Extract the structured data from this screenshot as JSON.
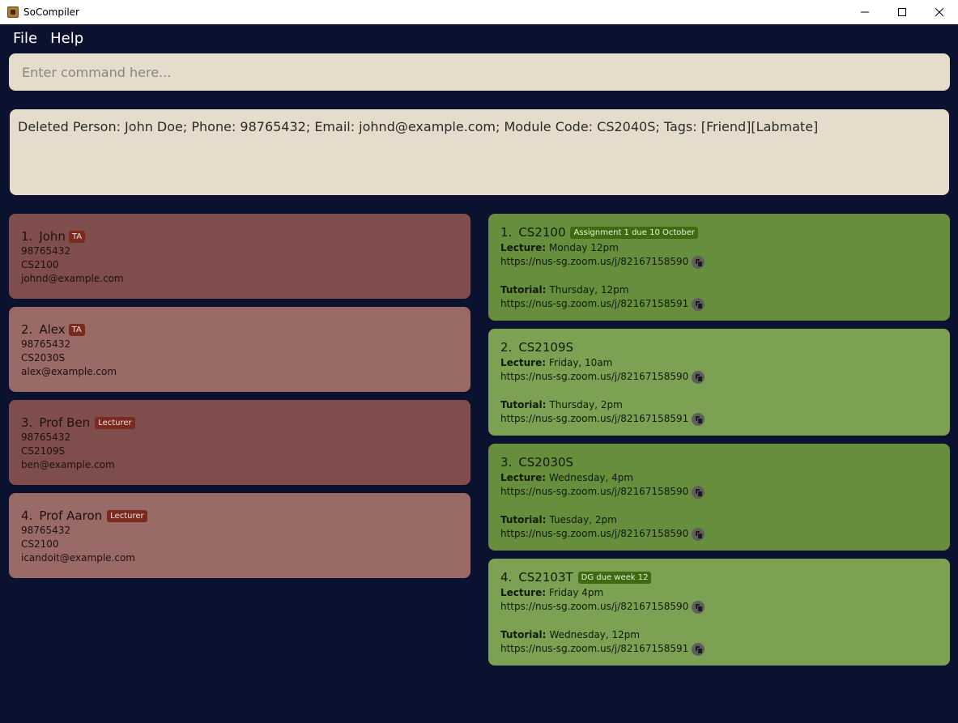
{
  "window": {
    "title": "SoCompiler",
    "controls": [
      "minimize",
      "maximize",
      "close"
    ]
  },
  "menu": {
    "file": "File",
    "help": "Help"
  },
  "command": {
    "placeholder": "Enter command here..."
  },
  "result": {
    "text": "Deleted Person: John Doe; Phone: 98765432; Email: johnd@example.com; Module Code: CS2040S; Tags: [Friend][Labmate]"
  },
  "persons": [
    {
      "index": "1.",
      "name": "John",
      "tag": "TA",
      "phone": "98765432",
      "module": "CS2100",
      "email": "johnd@example.com"
    },
    {
      "index": "2.",
      "name": "Alex",
      "tag": "TA",
      "phone": "98765432",
      "module": "CS2030S",
      "email": "alex@example.com"
    },
    {
      "index": "3.",
      "name": "Prof Ben",
      "tag": "Lecturer",
      "phone": "98765432",
      "module": "CS2109S",
      "email": "ben@example.com"
    },
    {
      "index": "4.",
      "name": "Prof Aaron",
      "tag": "Lecturer",
      "phone": "98765432",
      "module": "CS2100",
      "email": "icandoit@example.com"
    }
  ],
  "modules": [
    {
      "index": "1.",
      "code": "CS2100",
      "tag": "Assignment 1 due 10 October",
      "lecture_label": "Lecture:",
      "lecture_time": "Monday 12pm",
      "lecture_link": "https://nus-sg.zoom.us/j/82167158590",
      "tutorial_label": "Tutorial:",
      "tutorial_time": "Thursday, 12pm",
      "tutorial_link": "https://nus-sg.zoom.us/j/82167158591"
    },
    {
      "index": "2.",
      "code": "CS2109S",
      "tag": "",
      "lecture_label": "Lecture:",
      "lecture_time": "Friday, 10am",
      "lecture_link": "https://nus-sg.zoom.us/j/82167158590",
      "tutorial_label": "Tutorial:",
      "tutorial_time": "Thursday, 2pm",
      "tutorial_link": "https://nus-sg.zoom.us/j/82167158591"
    },
    {
      "index": "3.",
      "code": "CS2030S",
      "tag": "",
      "lecture_label": "Lecture:",
      "lecture_time": "Wednesday, 4pm",
      "lecture_link": "https://nus-sg.zoom.us/j/82167158590",
      "tutorial_label": "Tutorial:",
      "tutorial_time": "Tuesday, 2pm",
      "tutorial_link": "https://nus-sg.zoom.us/j/82167158590"
    },
    {
      "index": "4.",
      "code": "CS2103T",
      "tag": "DG due week 12",
      "lecture_label": "Lecture:",
      "lecture_time": "Friday 4pm",
      "lecture_link": "https://nus-sg.zoom.us/j/82167158590",
      "tutorial_label": "Tutorial:",
      "tutorial_time": "Wednesday, 12pm",
      "tutorial_link": "https://nus-sg.zoom.us/j/82167158591"
    }
  ],
  "colors": {
    "background": "#0b1230",
    "command_bg": "#e6dccc",
    "person_dark": "#7f4e4c",
    "person_light": "#9a6a67",
    "module_dark": "#678e3d",
    "module_light": "#7da153",
    "tag_red": "#7a2a1f",
    "tag_green": "#3e6a12"
  }
}
